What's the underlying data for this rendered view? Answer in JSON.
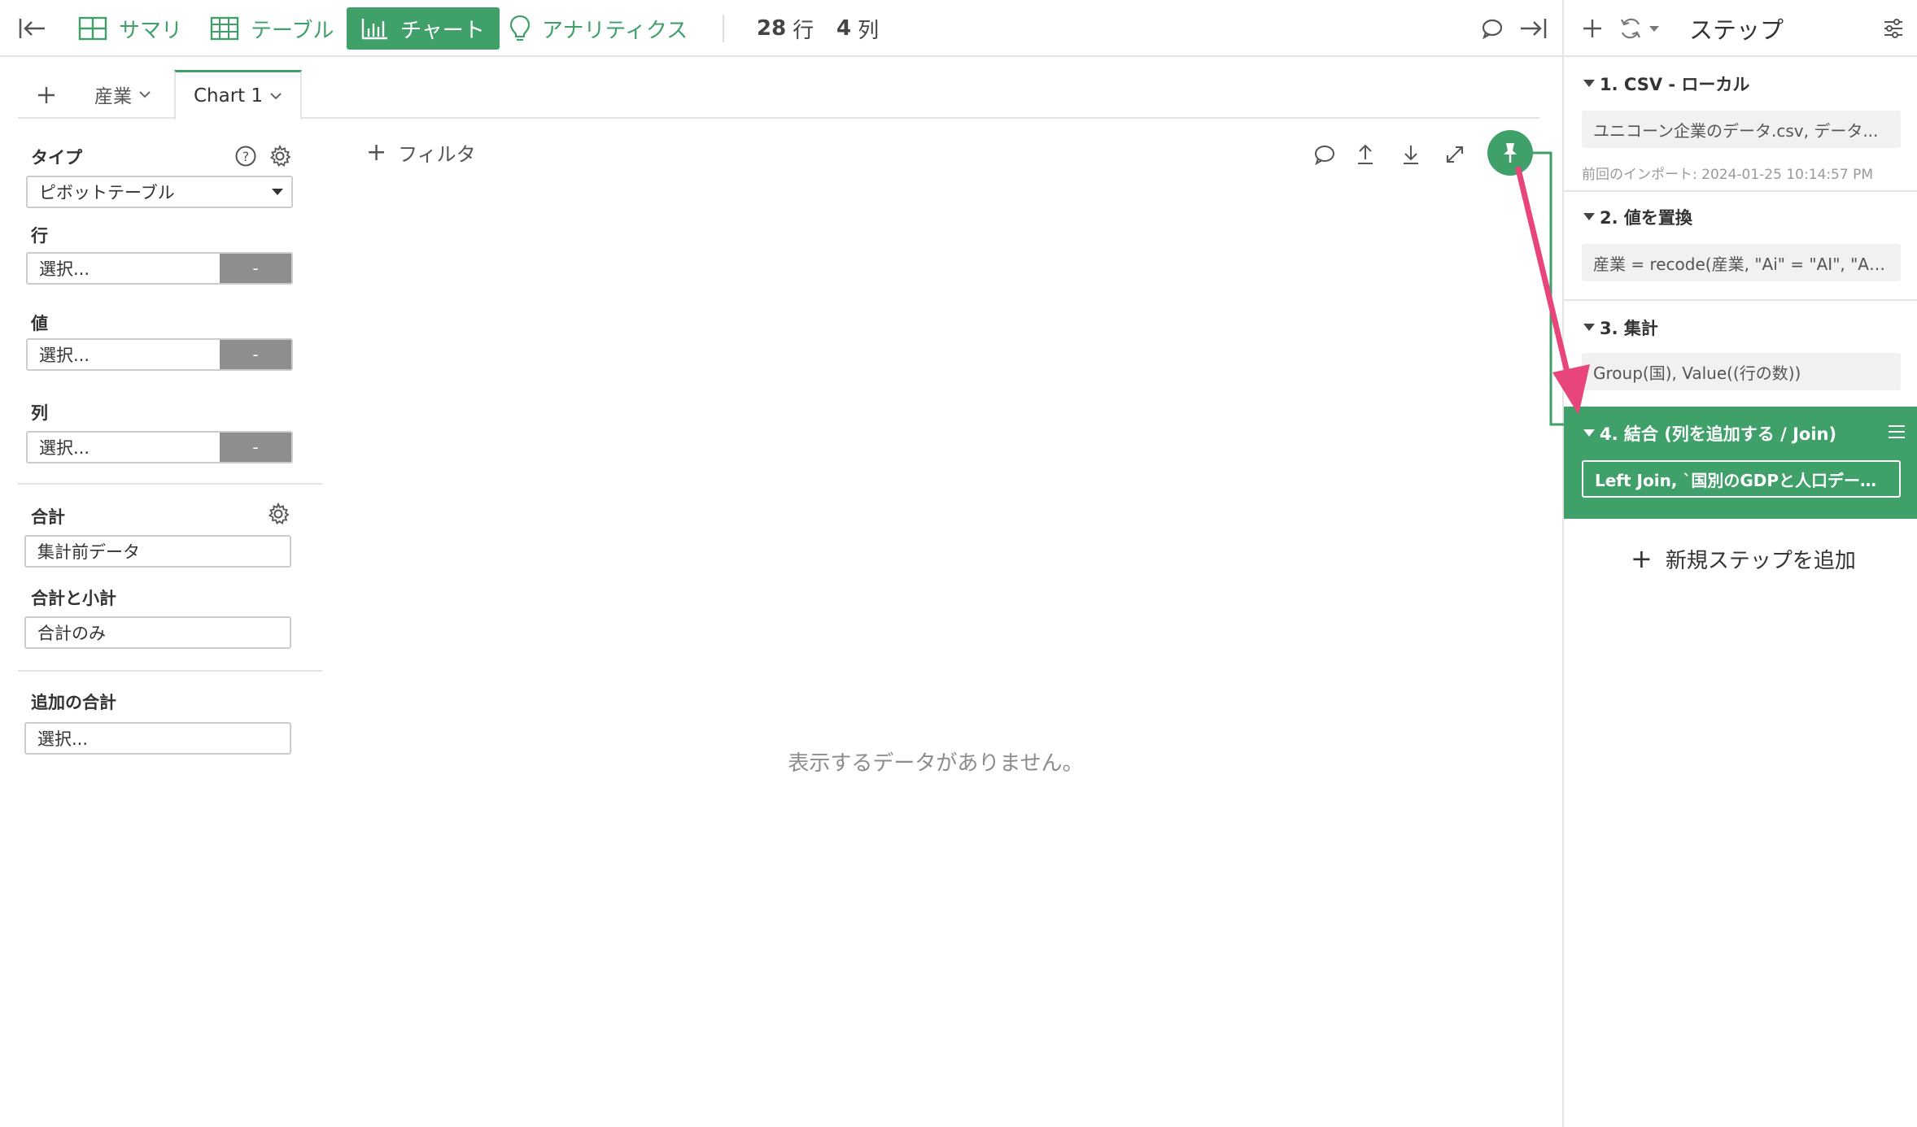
{
  "toolbar": {
    "summary_label": "サマリ",
    "table_label": "テーブル",
    "chart_label": "チャート",
    "analytics_label": "アナリティクス",
    "rows_count": "28",
    "rows_unit": "行",
    "cols_count": "4",
    "cols_unit": "列"
  },
  "tabs": [
    {
      "label": "産業"
    },
    {
      "label": "Chart 1"
    }
  ],
  "config": {
    "type_label": "タイプ",
    "type_value": "ピボットテーブル",
    "row_label": "行",
    "row_placeholder": "選択...",
    "row_btn": "-",
    "value_label": "値",
    "value_placeholder": "選択...",
    "value_btn": "-",
    "col_label": "列",
    "col_placeholder": "選択...",
    "col_btn": "-",
    "total_label": "合計",
    "total_value": "集計前データ",
    "subtotal_label": "合計と小計",
    "subtotal_value": "合計のみ",
    "extra_total_label": "追加の合計",
    "extra_total_value": "選択..."
  },
  "chart_area": {
    "filter_label": "フィルタ",
    "empty_message": "表示するデータがありません。"
  },
  "steps_panel": {
    "title": "ステップ",
    "steps": [
      {
        "title": "1. CSV - ローカル",
        "detail": "ユニコーン企業のデータ.csv, データ...",
        "sub": "前回のインポート: 2024-01-25 10:14:57 PM"
      },
      {
        "title": "2. 値を置換",
        "detail": "産業 = recode(産業, \"Ai\" = \"AI\", \"Artificial..."
      },
      {
        "title": "3. 集計",
        "detail": "Group(国), Value((行の数))"
      },
      {
        "title": "4. 結合 (列を追加する / Join)",
        "detail": "Left Join, `国別のGDPと人口データ..."
      }
    ],
    "add_step_label": "新規ステップを追加"
  },
  "colors": {
    "accent": "#3fa06a",
    "arrow": "#e8457a",
    "button_gray": "#8e8e8e"
  },
  "icons": {
    "collapse_left": "collapse-left-icon",
    "comment": "comment-icon",
    "collapse_right": "collapse-right-icon",
    "pin": "pin-icon",
    "help": "help-icon",
    "gear": "gear-icon",
    "upload": "upload-icon",
    "download": "download-icon",
    "expand": "expand-icon",
    "refresh": "refresh-icon",
    "settings_sliders": "sliders-icon",
    "menu": "menu-icon"
  }
}
